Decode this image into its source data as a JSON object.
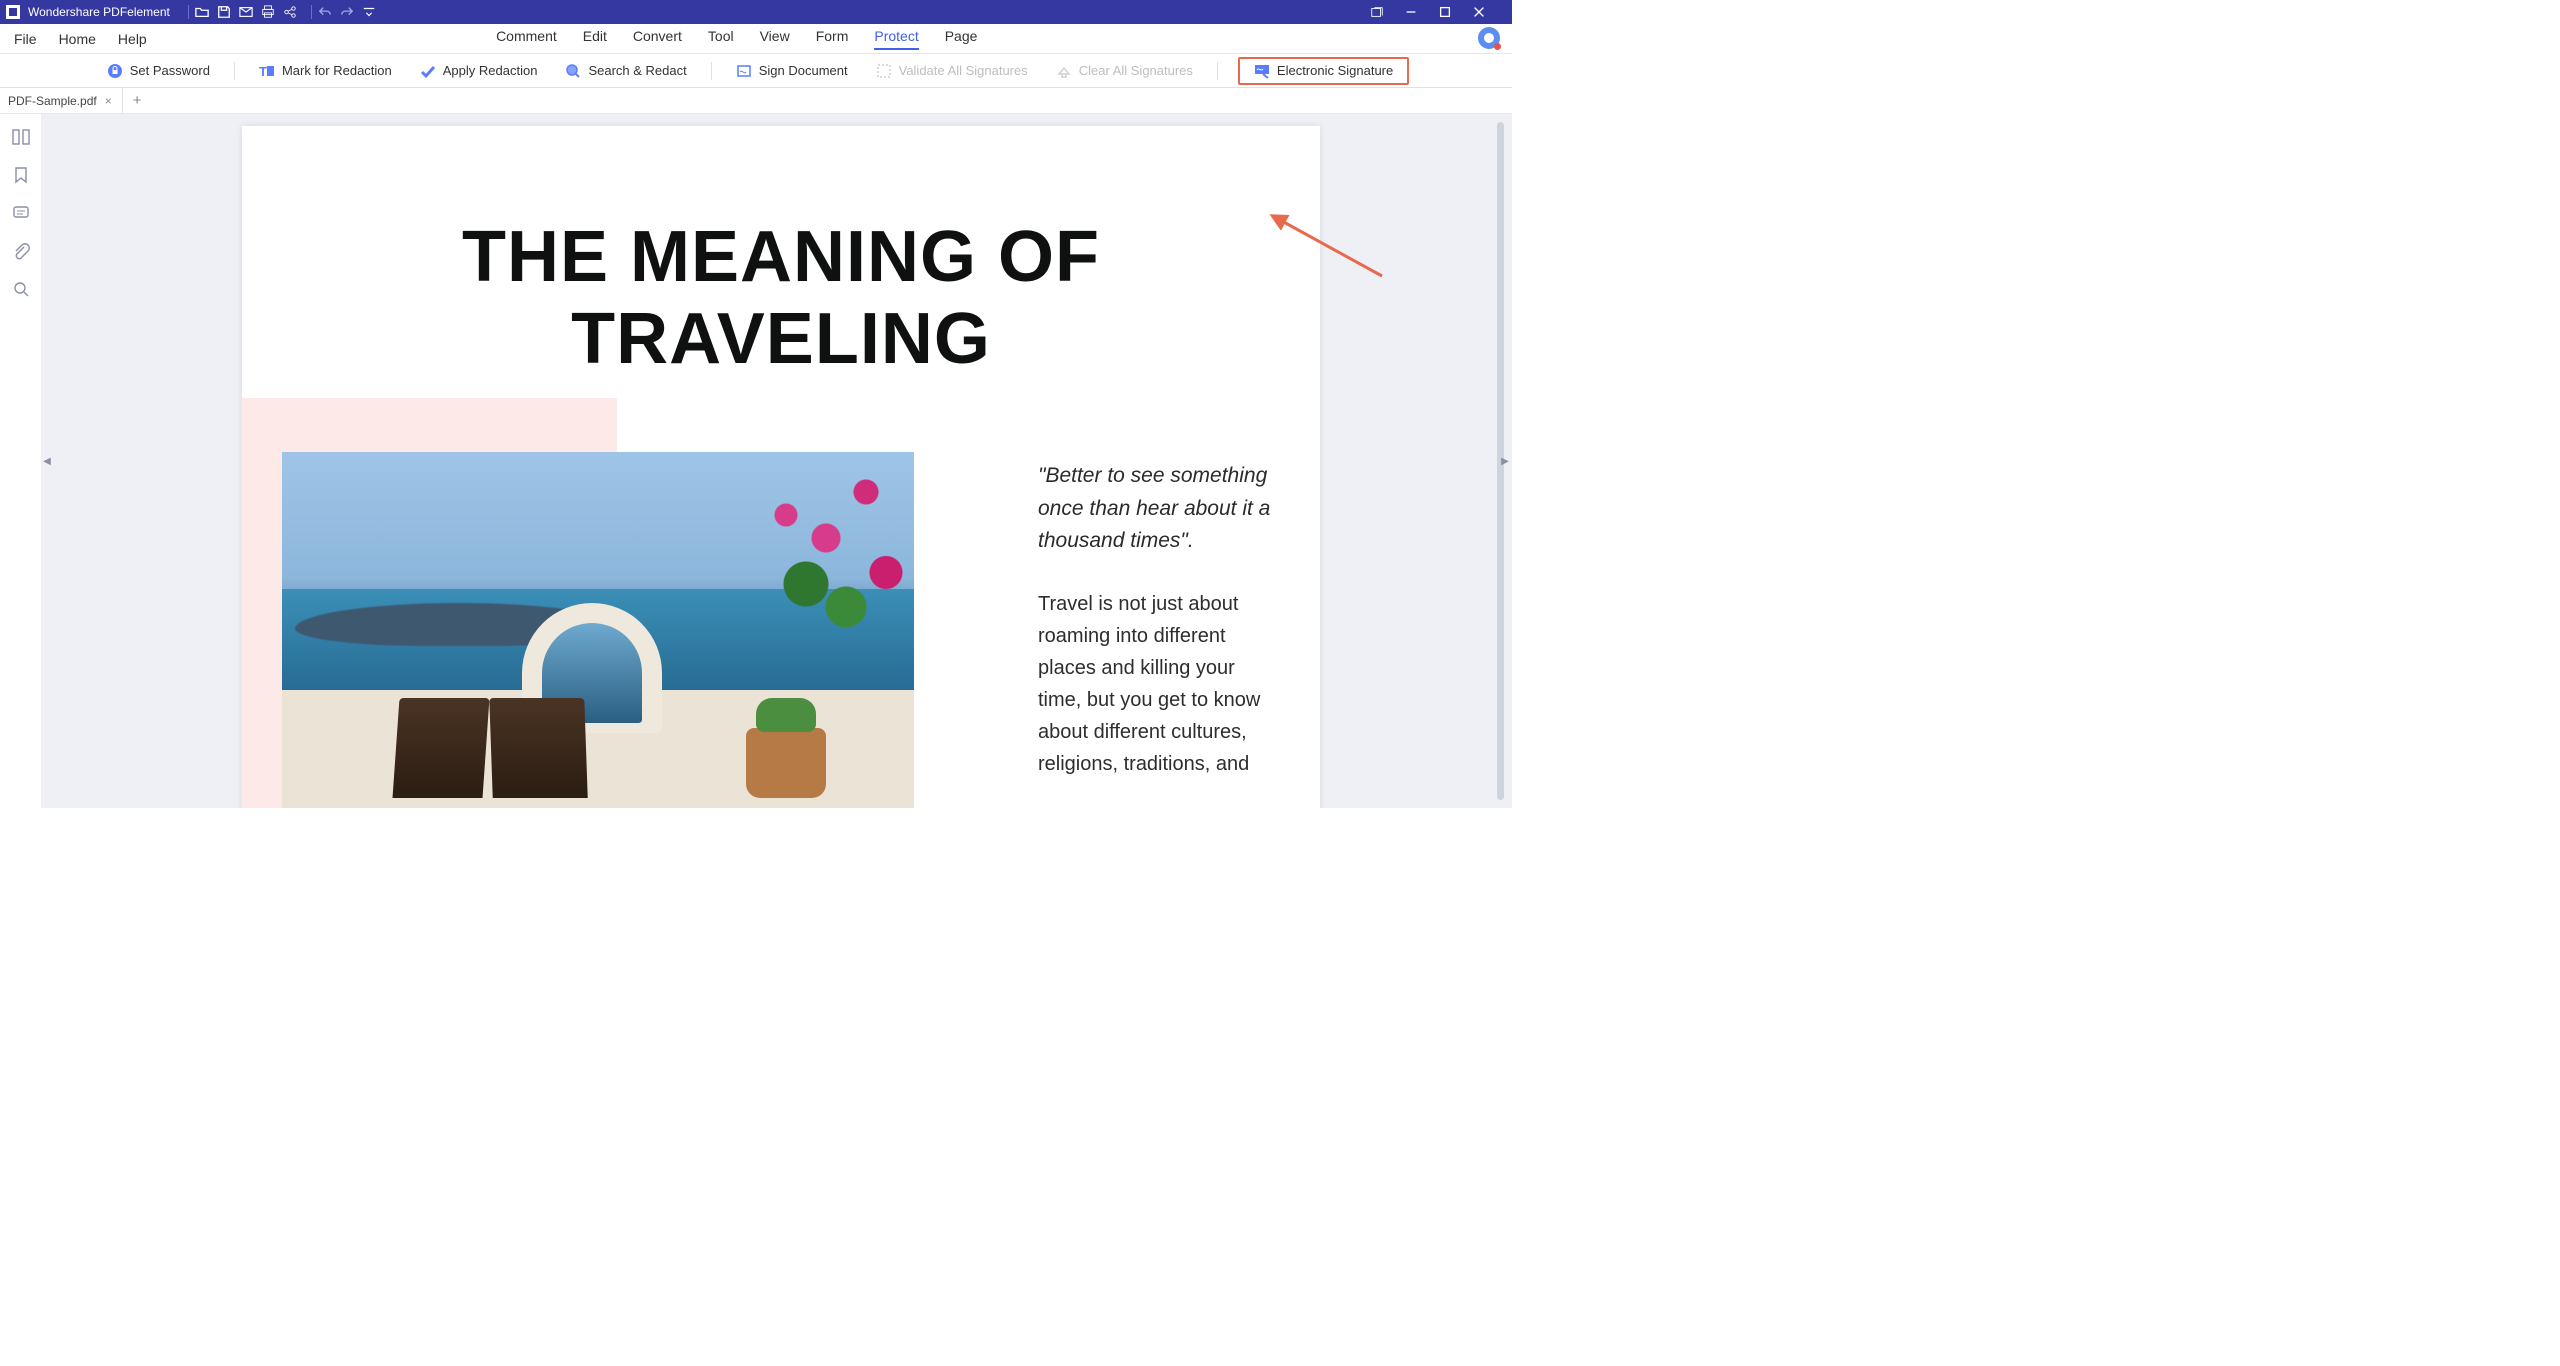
{
  "titlebar": {
    "app_name": "Wondershare PDFelement"
  },
  "menu": {
    "left": [
      "File",
      "Home",
      "Help"
    ],
    "center": [
      "Comment",
      "Edit",
      "Convert",
      "Tool",
      "View",
      "Form",
      "Protect",
      "Page"
    ],
    "active": "Protect"
  },
  "ribbon": {
    "set_password": "Set Password",
    "mark_redaction": "Mark for Redaction",
    "apply_redaction": "Apply Redaction",
    "search_redact": "Search & Redact",
    "sign_document": "Sign Document",
    "validate_signatures": "Validate All Signatures",
    "clear_signatures": "Clear All Signatures",
    "electronic_signature": "Electronic Signature"
  },
  "tabs": {
    "doc": "PDF-Sample.pdf"
  },
  "document": {
    "title": "THE MEANING OF TRAVELING",
    "quote": "\"Better to see something once than hear about it a thousand times\".",
    "body": "Travel is not just about roaming into different places and killing your time, but you get to know about different cultures, religions, traditions, and"
  }
}
